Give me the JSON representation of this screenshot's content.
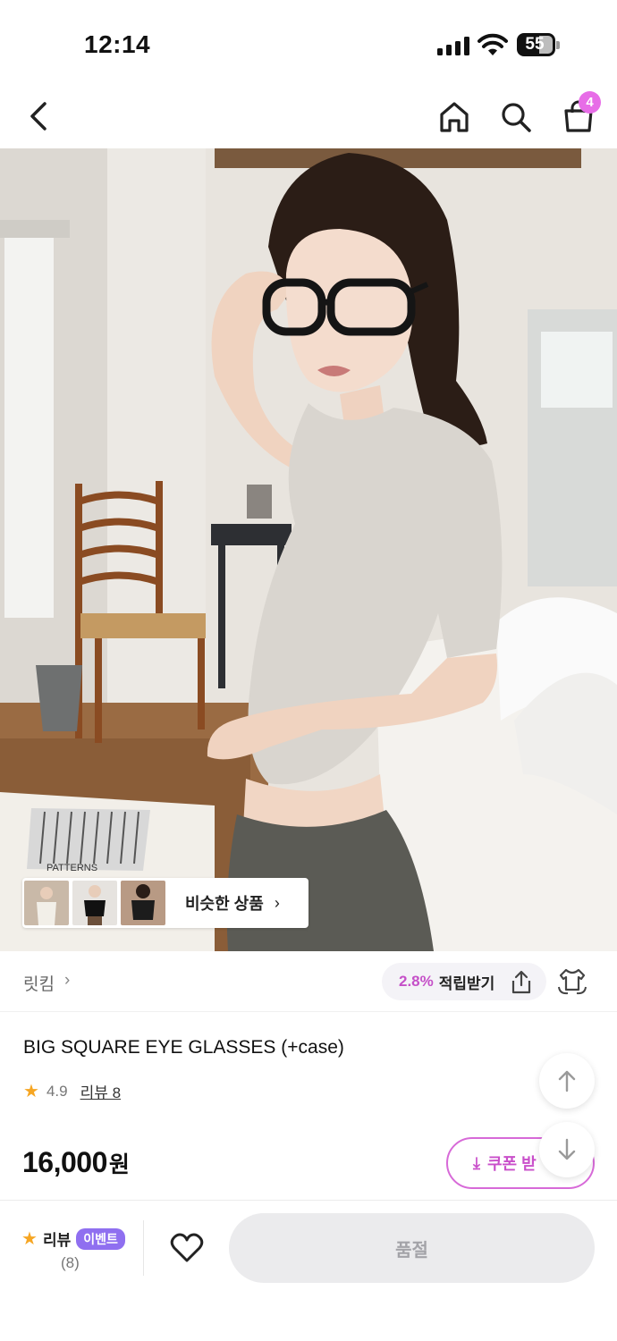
{
  "status_bar": {
    "time": "12:14",
    "battery": "55"
  },
  "nav": {
    "cart_count": "4",
    "icons": [
      "back-icon",
      "home-icon",
      "search-icon",
      "shopping-bag-icon"
    ]
  },
  "hero": {
    "similar_label": "비슷한 상품",
    "similar_chevron": "›",
    "book_text": "PATTERNS"
  },
  "shop": {
    "name": "릿킴",
    "chevron": "›",
    "reward_pct": "2.8%",
    "reward_label": "적립받기"
  },
  "product": {
    "title": "BIG SQUARE EYE GLASSES (+case)",
    "rating": "4.9",
    "reviews_label": "리뷰 8",
    "price": "16,000",
    "currency": "원",
    "coupon_label": "쿠폰 받"
  },
  "bottom_bar": {
    "review_label": "리뷰",
    "event_badge": "이벤트",
    "review_count": "(8)",
    "sold_out": "품절"
  },
  "colors": {
    "accent_pink": "#e76de7",
    "coupon_pink": "#c94fca",
    "event_purple": "#8f6ff0",
    "star_orange": "#f6a623"
  }
}
